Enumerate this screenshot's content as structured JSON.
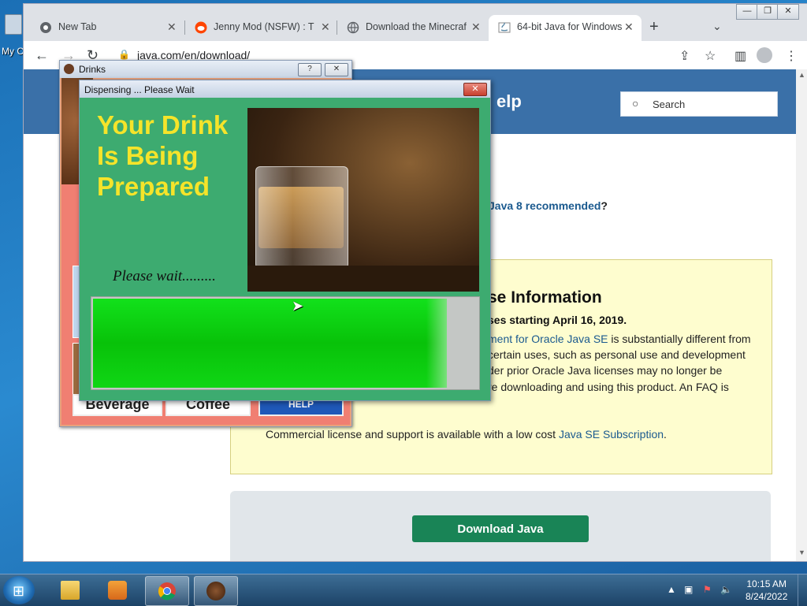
{
  "desktop": {
    "icon_label": "My C"
  },
  "browser": {
    "tabs": [
      {
        "label": "New Tab",
        "icon": "chrome-icon"
      },
      {
        "label": "Jenny Mod (NSFW) : The",
        "icon": "reddit-icon"
      },
      {
        "label": "Download the Minecraft",
        "icon": "globe-icon"
      },
      {
        "label": "64-bit Java for Windows",
        "icon": "java-icon"
      }
    ],
    "new_tab_symbol": "+",
    "close_symbol": "✕",
    "url": "java.com/en/download/",
    "window_controls": {
      "minimize": "—",
      "maximize": "❐",
      "close": "✕"
    }
  },
  "page": {
    "header_fragment": "elp",
    "search_label": "Search",
    "recommended_text": "Java 8 recommended",
    "recommended_q": "?",
    "license": {
      "title": "se Information",
      "subtitle": "ses starting April 16, 2019.",
      "line1_link": "ment for Oracle Java SE",
      "line1_rest": " is substantially different from",
      "line2": "certain uses, such as personal use and development",
      "line3": "der prior Oracle Java licenses may no longer be",
      "line4": "re downloading and using this product. An FAQ is",
      "commercial_text": "Commercial license and support is available with a low cost ",
      "commercial_link": "Java SE Subscription",
      "commercial_end": "."
    },
    "download_button": "Download Java"
  },
  "drinks_window": {
    "title": "Drinks",
    "help": "?",
    "close": "✕",
    "tiles": [
      "Beverage",
      "Coffee",
      "HELP"
    ]
  },
  "dispense_dialog": {
    "title": "Dispensing ... Please Wait",
    "close": "✕",
    "headline_1": "Your Drink",
    "headline_2": "Is Being",
    "headline_3": "Prepared",
    "wait_text": "Please wait.........",
    "progress": 0.92
  },
  "taskbar": {
    "time": "10:15 AM",
    "date": "8/24/2022",
    "tray_arrow": "▲"
  },
  "colors": {
    "dialog_green": "#3dab70",
    "headline_yellow": "#f5e42a",
    "progress_green": "#08c209",
    "download_green": "#198456",
    "java_blue": "#3a70a8"
  }
}
